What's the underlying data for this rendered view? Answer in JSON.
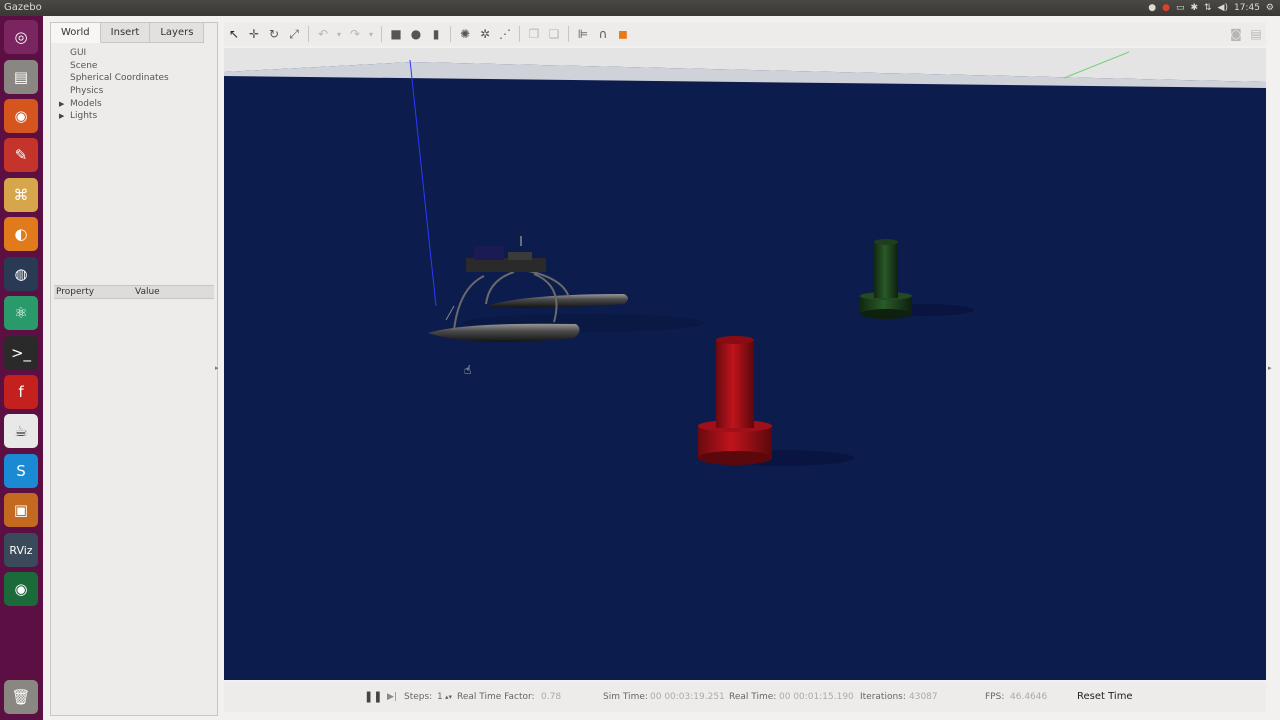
{
  "window_title": "Gazebo",
  "tray": {
    "clock": "17:45"
  },
  "left_panel": {
    "tabs": [
      "World",
      "Insert",
      "Layers"
    ],
    "tree": [
      {
        "label": "GUI",
        "expandable": false
      },
      {
        "label": "Scene",
        "expandable": false
      },
      {
        "label": "Spherical Coordinates",
        "expandable": false
      },
      {
        "label": "Physics",
        "expandable": false
      },
      {
        "label": "Models",
        "expandable": true
      },
      {
        "label": "Lights",
        "expandable": true
      }
    ],
    "property_header": "Property",
    "value_header": "Value"
  },
  "bottom": {
    "steps_label": "Steps:",
    "steps_value": "1",
    "rtf_label": "Real Time Factor:",
    "rtf_value": "0.78",
    "sim_time_label": "Sim Time:",
    "sim_time_value": "00 00:03:19.251",
    "real_time_label": "Real Time:",
    "real_time_value": "00 00:01:15.190",
    "iterations_label": "Iterations:",
    "iterations_value": "43087",
    "fps_label": "FPS:",
    "fps_value": "46.4646",
    "reset_label": "Reset Time"
  },
  "colors": {
    "launcher": "#5c0f42",
    "viewport_bg": "#0c1c4d",
    "red_buoy": "#b01018",
    "green_buoy": "#1f4a1f"
  }
}
